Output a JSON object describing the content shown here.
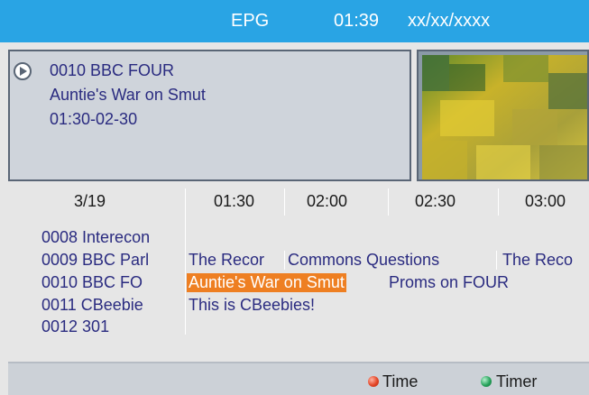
{
  "header": {
    "title": "EPG",
    "time": "01:39",
    "date": "xx/xx/xxxx",
    "bg_color": "#29a4e4"
  },
  "info": {
    "icon": "play-circle-icon",
    "channel": "0010 BBC FOUR",
    "program": "Auntie's War on Smut",
    "time_range": "01:30-02-30"
  },
  "schedule": {
    "date_label": "3/19",
    "time_ticks": [
      "01:30",
      "02:00",
      "02:30",
      "03:00"
    ],
    "channels": [
      {
        "name": "0008 Interecon",
        "programs": []
      },
      {
        "name": "0009 BBC Parl",
        "programs": [
          "The Recor",
          "Commons Questions",
          "The Reco"
        ]
      },
      {
        "name": "0010 BBC FO",
        "programs": [
          "Auntie's War on Smut",
          "Proms on FOUR"
        ]
      },
      {
        "name": "0011 CBeebie",
        "programs": [
          "This is CBeebies!"
        ]
      },
      {
        "name": "0012 301",
        "programs": []
      }
    ],
    "selected_color": "#ee7f22"
  },
  "footer": {
    "red_label": "Time",
    "green_label": "Timer",
    "red_color": "#e34526",
    "green_color": "#27a35b"
  }
}
